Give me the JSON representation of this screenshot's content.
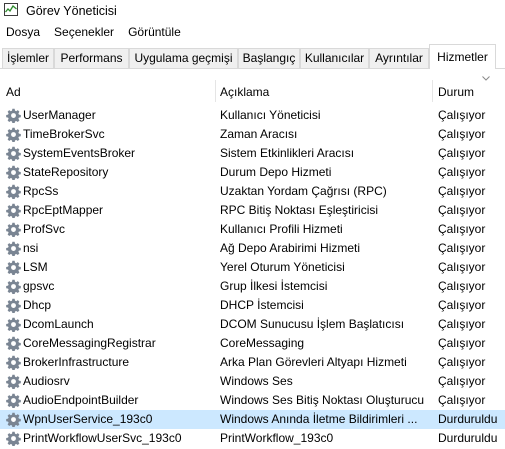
{
  "window": {
    "title": "Görev Yöneticisi",
    "icon": "task-manager-icon"
  },
  "menu": [
    "Dosya",
    "Seçenekler",
    "Görüntüle"
  ],
  "tabs": [
    {
      "label": "İşlemler",
      "active": false
    },
    {
      "label": "Performans",
      "active": false
    },
    {
      "label": "Uygulama geçmişi",
      "active": false
    },
    {
      "label": "Başlangıç",
      "active": false
    },
    {
      "label": "Kullanıcılar",
      "active": false
    },
    {
      "label": "Ayrıntılar",
      "active": false
    },
    {
      "label": "Hizmetler",
      "active": true
    }
  ],
  "columns": {
    "name": "Ad",
    "description": "Açıklama",
    "status": "Durum"
  },
  "services": [
    {
      "name": "UserManager",
      "description": "Kullanıcı Yöneticisi",
      "status": "Çalışıyor",
      "selected": false
    },
    {
      "name": "TimeBrokerSvc",
      "description": "Zaman Aracısı",
      "status": "Çalışıyor",
      "selected": false
    },
    {
      "name": "SystemEventsBroker",
      "description": "Sistem Etkinlikleri Aracısı",
      "status": "Çalışıyor",
      "selected": false
    },
    {
      "name": "StateRepository",
      "description": "Durum Depo Hizmeti",
      "status": "Çalışıyor",
      "selected": false
    },
    {
      "name": "RpcSs",
      "description": "Uzaktan Yordam Çağrısı (RPC)",
      "status": "Çalışıyor",
      "selected": false
    },
    {
      "name": "RpcEptMapper",
      "description": "RPC Bitiş Noktası Eşleştiricisi",
      "status": "Çalışıyor",
      "selected": false
    },
    {
      "name": "ProfSvc",
      "description": "Kullanıcı Profili Hizmeti",
      "status": "Çalışıyor",
      "selected": false
    },
    {
      "name": "nsi",
      "description": "Ağ Depo Arabirimi Hizmeti",
      "status": "Çalışıyor",
      "selected": false
    },
    {
      "name": "LSM",
      "description": "Yerel Oturum Yöneticisi",
      "status": "Çalışıyor",
      "selected": false
    },
    {
      "name": "gpsvc",
      "description": "Grup İlkesi İstemcisi",
      "status": "Çalışıyor",
      "selected": false
    },
    {
      "name": "Dhcp",
      "description": "DHCP İstemcisi",
      "status": "Çalışıyor",
      "selected": false
    },
    {
      "name": "DcomLaunch",
      "description": "DCOM Sunucusu İşlem Başlatıcısı",
      "status": "Çalışıyor",
      "selected": false
    },
    {
      "name": "CoreMessagingRegistrar",
      "description": "CoreMessaging",
      "status": "Çalışıyor",
      "selected": false
    },
    {
      "name": "BrokerInfrastructure",
      "description": "Arka Plan Görevleri Altyapı Hizmeti",
      "status": "Çalışıyor",
      "selected": false
    },
    {
      "name": "Audiosrv",
      "description": "Windows Ses",
      "status": "Çalışıyor",
      "selected": false
    },
    {
      "name": "AudioEndpointBuilder",
      "description": "Windows Ses Bitiş Noktası Oluşturucu",
      "status": "Çalışıyor",
      "selected": false
    },
    {
      "name": "WpnUserService_193c0",
      "description": "Windows Anında İletme Bildirimleri ...",
      "status": "Durduruldu",
      "selected": true
    },
    {
      "name": "PrintWorkflowUserSvc_193c0",
      "description": "PrintWorkflow_193c0",
      "status": "Durduruldu",
      "selected": false
    }
  ],
  "colors": {
    "selected_row": "#cce8ff",
    "gear_icon": "#7a8593",
    "tab_border": "#d9d9d9"
  }
}
